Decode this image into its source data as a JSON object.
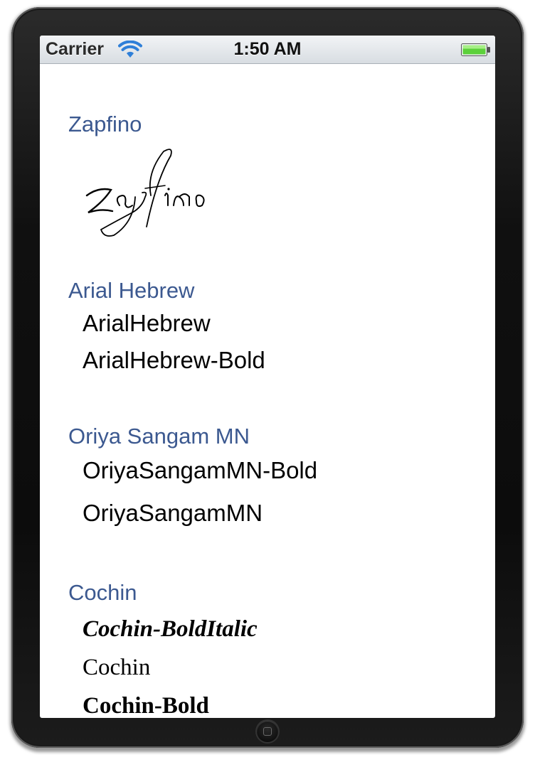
{
  "status_bar": {
    "carrier": "Carrier",
    "time": "1:50 AM",
    "signal_icon": "wifi-icon",
    "battery_icon": "battery-icon",
    "battery_color": "#5cd13b"
  },
  "sections": [
    {
      "header": "Zapfino",
      "items": [
        "Zapfino"
      ]
    },
    {
      "header": "Arial Hebrew",
      "items": [
        "ArialHebrew",
        "ArialHebrew-Bold"
      ]
    },
    {
      "header": "Oriya Sangam MN",
      "items": [
        "OriyaSangamMN-Bold",
        "OriyaSangamMN"
      ]
    },
    {
      "header": "Cochin",
      "items": [
        "Cochin-BoldItalic",
        "Cochin",
        "Cochin-Bold"
      ]
    }
  ],
  "colors": {
    "section_header": "#3c5990",
    "item_text": "#000000",
    "device_bezel": "#111111"
  },
  "device": {
    "home_button_icon": "home-button-icon"
  }
}
